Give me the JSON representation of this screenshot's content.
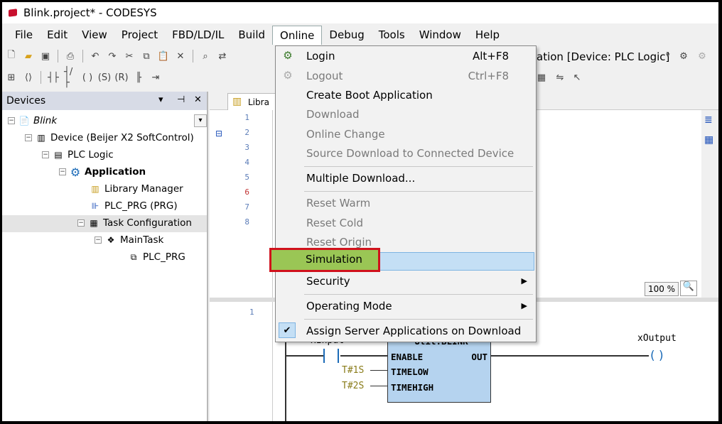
{
  "window": {
    "title": "Blink.project* - CODESYS"
  },
  "menubar": [
    "File",
    "Edit",
    "View",
    "Project",
    "FBD/LD/IL",
    "Build",
    "Online",
    "Debug",
    "Tools",
    "Window",
    "Help"
  ],
  "toolbar": {
    "app_selector": "ation [Device: PLC Logic]"
  },
  "devices": {
    "title": "Devices",
    "tree": [
      {
        "label": "Blink",
        "icon": "project-icon"
      },
      {
        "label": "Device (Beijer X2 SoftControl)",
        "icon": "device-icon"
      },
      {
        "label": "PLC Logic",
        "icon": "plc-logic-icon"
      },
      {
        "label": "Application",
        "icon": "application-gear-icon"
      },
      {
        "label": "Library Manager",
        "icon": "library-manager-icon"
      },
      {
        "label": "PLC_PRG (PRG)",
        "icon": "program-icon"
      },
      {
        "label": "Task Configuration",
        "icon": "task-config-icon"
      },
      {
        "label": "MainTask",
        "icon": "task-icon"
      },
      {
        "label": "PLC_PRG",
        "icon": "program-call-icon"
      }
    ]
  },
  "editor": {
    "tab_label": "Libra",
    "line_numbers": [
      "1",
      "2",
      "3",
      "4",
      "5",
      "6",
      "7",
      "8"
    ],
    "zoom": "100 %",
    "network_number": "1",
    "ladder": {
      "contact_label": "xInput",
      "fb_title": "Util.BLINK",
      "fb_inputs": [
        "ENABLE",
        "TIMELOW",
        "TIMEHIGH"
      ],
      "fb_output": "OUT",
      "timelow_value": "T#1S",
      "timehigh_value": "T#2S",
      "coil_label": "xOutput"
    }
  },
  "online_menu": {
    "items": [
      {
        "label": "Login",
        "shortcut": "Alt+F8",
        "enabled": true
      },
      {
        "label": "Logout",
        "shortcut": "Ctrl+F8",
        "enabled": false
      },
      {
        "label": "Create Boot Application",
        "enabled": true
      },
      {
        "label": "Download",
        "enabled": false
      },
      {
        "label": "Online Change",
        "enabled": false
      },
      {
        "label": "Source Download to Connected Device",
        "enabled": false
      },
      {
        "label": "Multiple Download...",
        "enabled": true
      },
      {
        "label": "Reset Warm",
        "enabled": false
      },
      {
        "label": "Reset Cold",
        "enabled": false
      },
      {
        "label": "Reset Origin",
        "enabled": false
      },
      {
        "label": "Simulation",
        "enabled": true,
        "highlighted": true
      },
      {
        "label": "Security",
        "enabled": true,
        "submenu": true
      },
      {
        "label": "Operating Mode",
        "enabled": true,
        "submenu": true
      },
      {
        "label": "Assign Server Applications on Download",
        "enabled": true,
        "checked": true
      }
    ]
  },
  "colors": {
    "highlight": "#c4dff5",
    "annotation_box": "#d0111c",
    "annotation_fill": "#9ac655",
    "fb_fill": "#b5d3ef"
  }
}
